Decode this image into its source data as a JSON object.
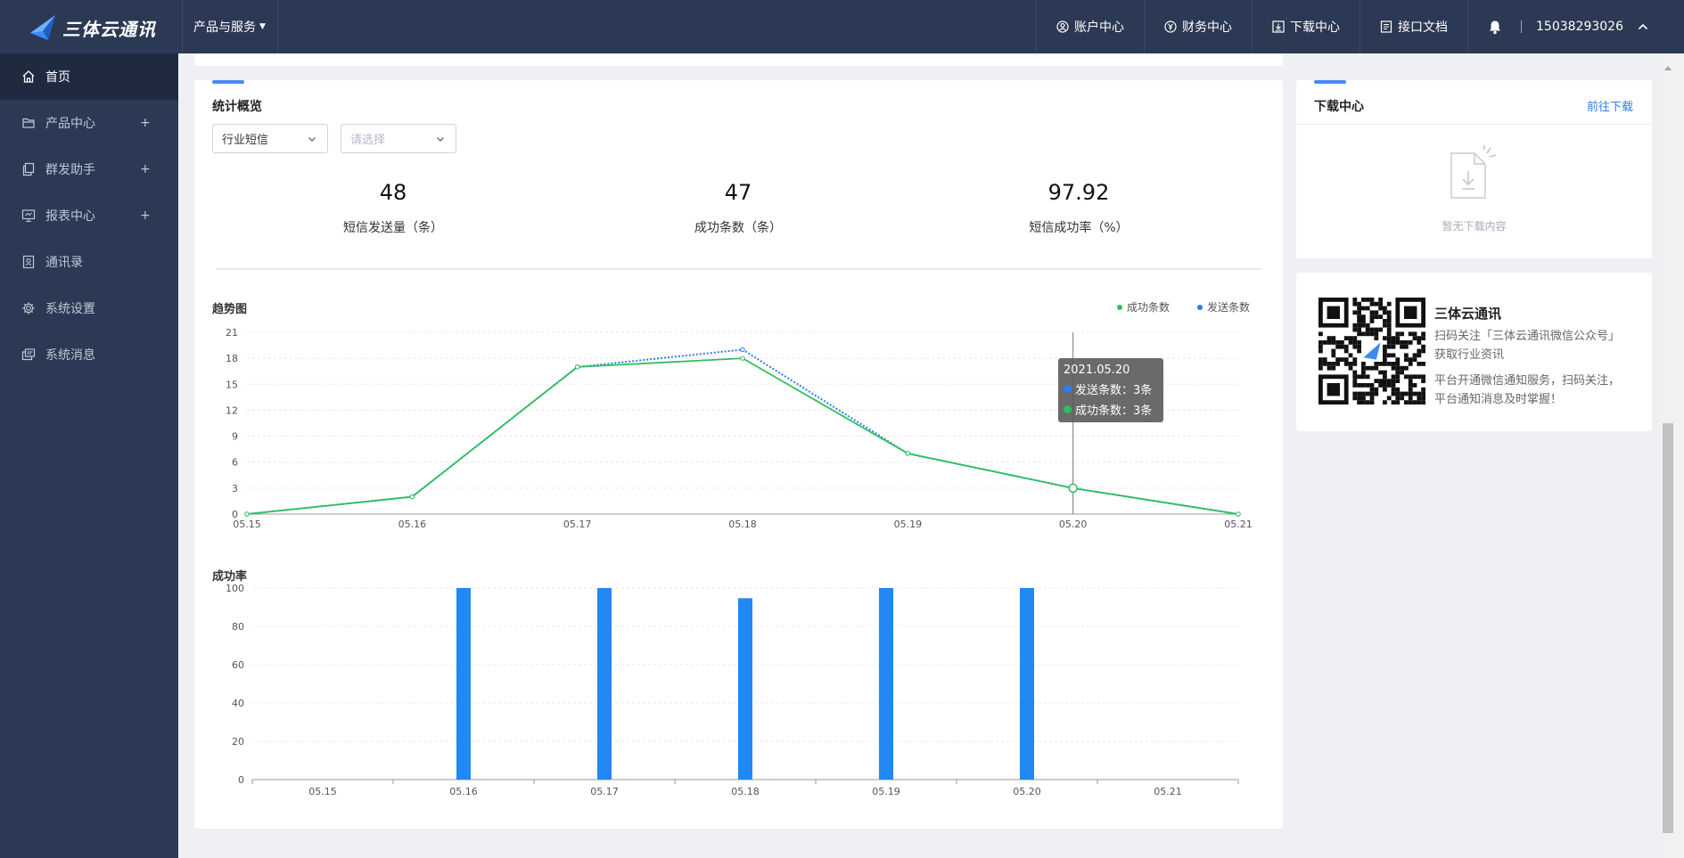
{
  "brand": {
    "name": "三体云通讯"
  },
  "topnav": {
    "products_label": "产品与服务",
    "links": [
      {
        "label": "账户中心",
        "icon": "user-circle-icon"
      },
      {
        "label": "财务中心",
        "icon": "yen-circle-icon"
      },
      {
        "label": "下载中心",
        "icon": "download-icon"
      },
      {
        "label": "接口文档",
        "icon": "document-icon"
      }
    ],
    "phone": "15038293026"
  },
  "sidebar": {
    "items": [
      {
        "label": "首页",
        "icon": "home-icon",
        "expandable": false,
        "active": true
      },
      {
        "label": "产品中心",
        "icon": "folder-icon",
        "expandable": true
      },
      {
        "label": "群发助手",
        "icon": "copy-icon",
        "expandable": true
      },
      {
        "label": "报表中心",
        "icon": "monitor-icon",
        "expandable": true
      },
      {
        "label": "通讯录",
        "icon": "contacts-icon",
        "expandable": false
      },
      {
        "label": "系统设置",
        "icon": "gear-icon",
        "expandable": false
      },
      {
        "label": "系统消息",
        "icon": "message-icon",
        "expandable": false
      }
    ],
    "expand_symbol": "+"
  },
  "overview": {
    "title": "统计概览",
    "select_type": "行业短信",
    "select_placeholder": "请选择",
    "stats": [
      {
        "value": "48",
        "label": "短信发送量（条）"
      },
      {
        "value": "47",
        "label": "成功条数（条）"
      },
      {
        "value": "97.92",
        "label": "短信成功率（%）"
      }
    ]
  },
  "trend": {
    "title": "趋势图",
    "legend": [
      {
        "name": "成功条数",
        "color": "#2ec05c"
      },
      {
        "name": "发送条数",
        "color": "#2f7bef"
      }
    ],
    "tooltip": {
      "date": "2021.05.20",
      "send": "发送条数：3条",
      "success": "成功条数：3条"
    }
  },
  "rate": {
    "title": "成功率"
  },
  "chart_data": [
    {
      "type": "line",
      "title": "趋势图",
      "x": [
        "05.15",
        "05.16",
        "05.17",
        "05.18",
        "05.19",
        "05.20",
        "05.21"
      ],
      "yticks": [
        0,
        3,
        6,
        9,
        12,
        15,
        18,
        21
      ],
      "ylim": [
        0,
        21
      ],
      "series": [
        {
          "name": "成功条数",
          "values": [
            0,
            2,
            17,
            18,
            7,
            3,
            0
          ],
          "color": "#2ec05c",
          "style": "solid"
        },
        {
          "name": "发送条数",
          "values": [
            0,
            2,
            17,
            19,
            7,
            3,
            0
          ],
          "color": "#2f7bef",
          "style": "dotted"
        }
      ],
      "grid": true,
      "legend": "top-right"
    },
    {
      "type": "bar",
      "title": "成功率",
      "categories": [
        "05.15",
        "05.16",
        "05.17",
        "05.18",
        "05.19",
        "05.20",
        "05.21"
      ],
      "values": [
        0,
        100,
        100,
        94.7,
        100,
        100,
        0
      ],
      "yticks": [
        0,
        20,
        40,
        60,
        80,
        100
      ],
      "ylim": [
        0,
        100
      ],
      "color": "#2288f3",
      "grid": true
    }
  ],
  "download": {
    "title": "下载中心",
    "link": "前往下载",
    "empty": "暂无下载内容"
  },
  "wechat": {
    "title": "三体云通讯",
    "lines": [
      "扫码关注「三体云通讯微信公众号」",
      "获取行业资讯",
      "平台开通微信通知服务，扫码关注，",
      "平台通知消息及时掌握！"
    ]
  }
}
